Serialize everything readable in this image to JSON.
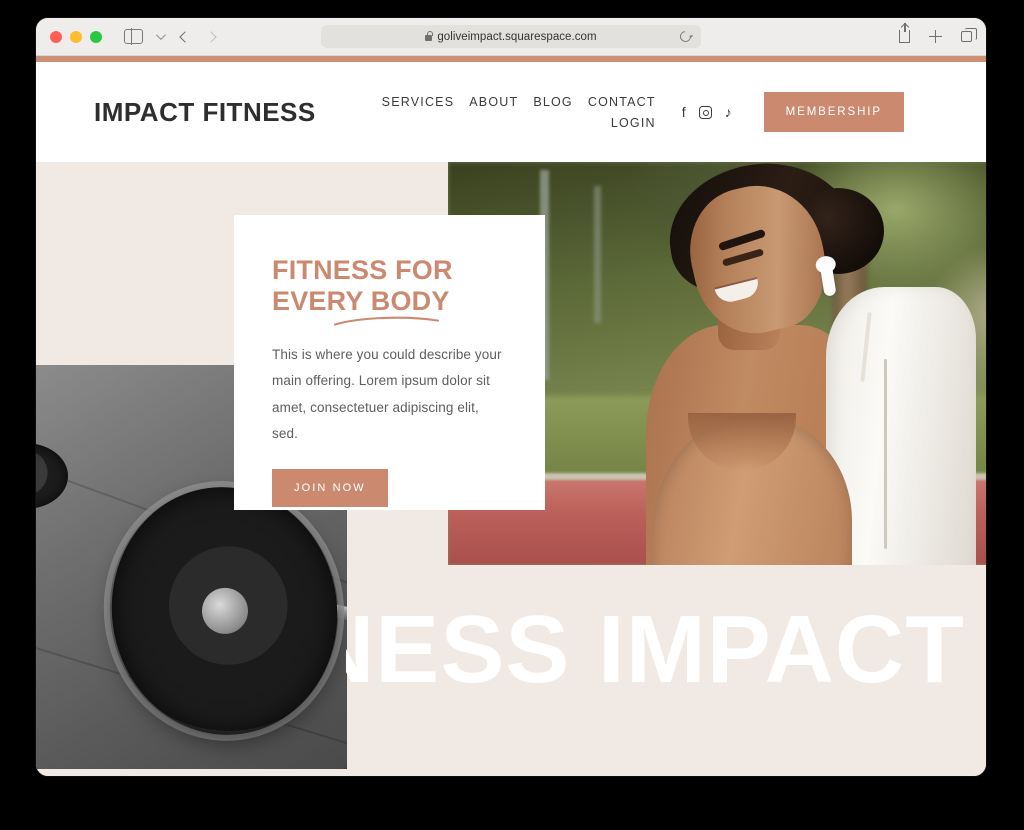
{
  "browser": {
    "traffic_lights": [
      "close",
      "minimize",
      "maximize"
    ],
    "sidebar_icon": "sidebar-icon",
    "tab_overview_chevron": "chevron-down-icon",
    "back_icon": "chevron-left-icon",
    "forward_icon": "chevron-right-icon",
    "url": "goliveimpact.squarespace.com",
    "lock_icon": "lock-icon",
    "reload_icon": "reload-icon",
    "share_icon": "share-icon",
    "new_tab_icon": "plus-icon",
    "tabs_icon": "tabs-icon"
  },
  "site": {
    "accent_color": "#cb8a70",
    "background_color": "#f1e9e3",
    "logo": "IMPACT FITNESS",
    "nav": [
      {
        "label": "SERVICES"
      },
      {
        "label": "ABOUT"
      },
      {
        "label": "BLOG"
      },
      {
        "label": "CONTACT"
      },
      {
        "label": "LOGIN"
      }
    ],
    "socials": [
      {
        "name": "facebook-icon",
        "glyph": "f"
      },
      {
        "name": "instagram-icon",
        "glyph": ""
      },
      {
        "name": "tiktok-icon",
        "glyph": "♪"
      }
    ],
    "membership_button": "MEMBERSHIP"
  },
  "hero": {
    "title_line1": "FITNESS FOR",
    "title_line2": "EVERY BODY",
    "title_color": "#cb8a70",
    "body": "This is where you could describe your main offering. Lorem ipsum dolor sit amet, consectetuer adipiscing elit, sed.",
    "cta": "JOIN NOW",
    "marquee_text": "FITNESS IMPACT",
    "marquee_color": "#ffffff",
    "images": [
      {
        "name": "barbell-photo",
        "alt": "Black and white barbell with weight plates on tiled gym floor"
      },
      {
        "name": "runner-photo",
        "alt": "Smiling woman in tan sports bra and white jacket wearing wireless earbuds outdoors by a running track"
      }
    ]
  }
}
